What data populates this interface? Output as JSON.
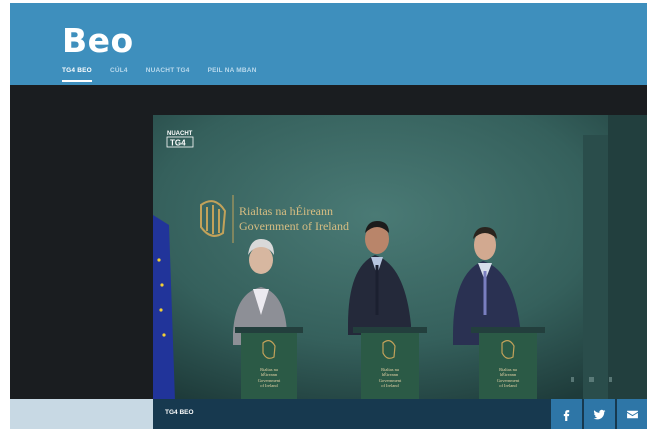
{
  "header": {
    "logo": "Beo"
  },
  "nav": {
    "items": [
      "TG4 BEO",
      "CÚL4",
      "NUACHT TG4",
      "PEIL NA MBAN"
    ],
    "active_index": 0
  },
  "video": {
    "watermark_top": "NUACHT",
    "watermark_bottom": "TG4",
    "backdrop_irish": "Rialtas na hÉireann",
    "backdrop_english": "Government of Ireland",
    "podium_text": [
      "Rialtas na",
      "hÉireann",
      "Government",
      "of Ireland"
    ]
  },
  "player_bar": {
    "title": "TG4 BEO"
  },
  "share": [
    "facebook-icon",
    "twitter-icon",
    "email-icon"
  ],
  "colors": {
    "header": "#3e8fbd",
    "page_bg": "#1a1d20",
    "player_bar": "#17394f",
    "share_btn": "#2e76a7"
  }
}
